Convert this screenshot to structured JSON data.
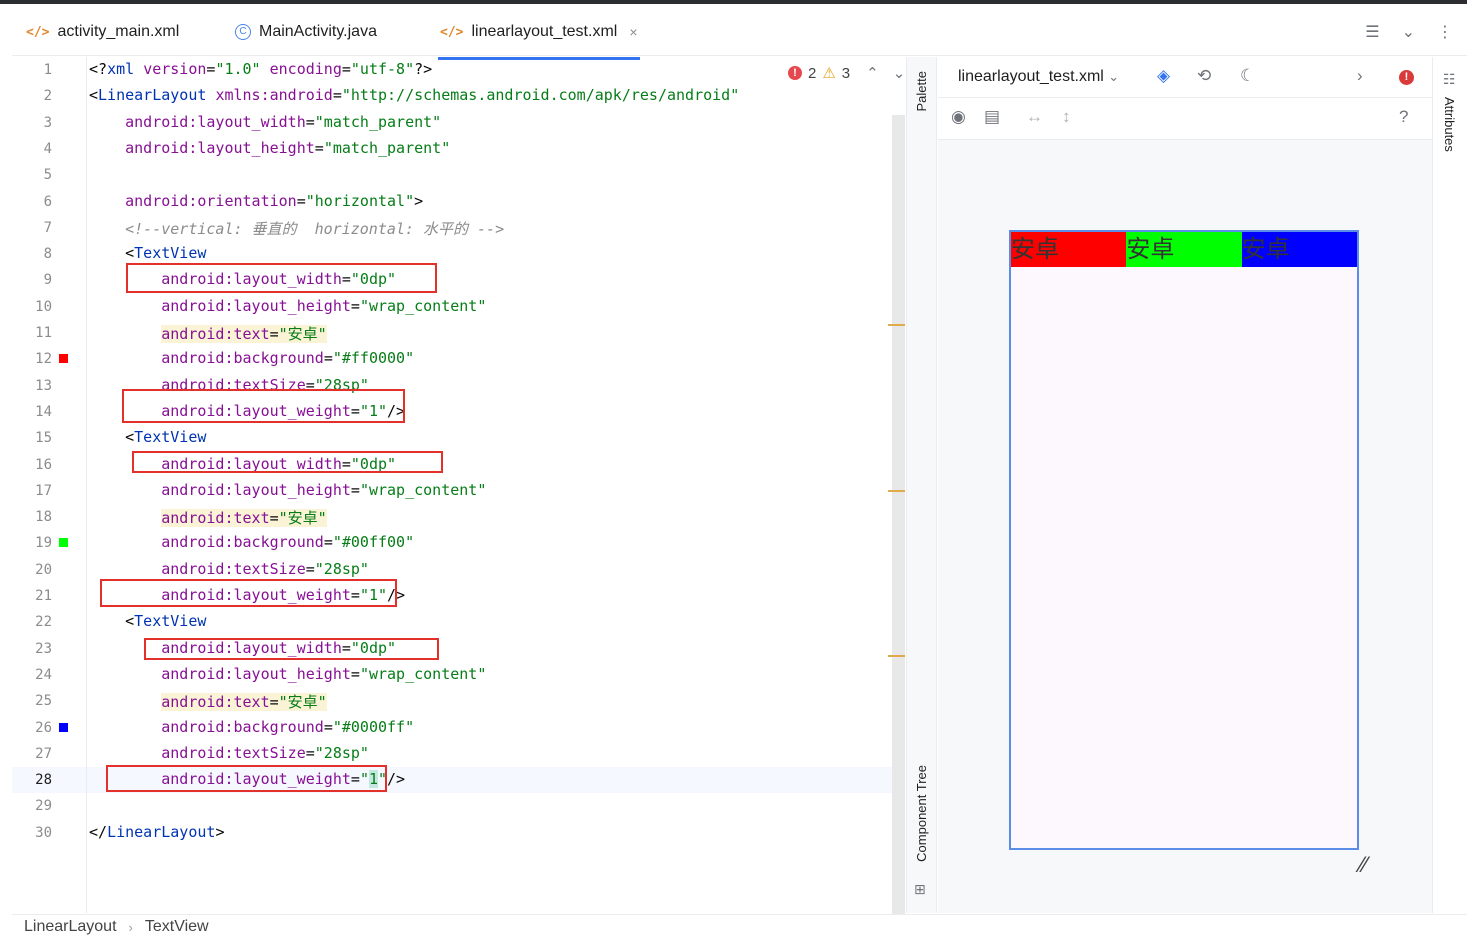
{
  "tabs": [
    {
      "label": "activity_main.xml",
      "icon": "xml-file-icon"
    },
    {
      "label": "MainActivity.java",
      "icon": "java-class-icon"
    },
    {
      "label": "linearlayout_test.xml",
      "icon": "xml-file-icon",
      "active": true
    }
  ],
  "tab_close": "×",
  "editor": {
    "status": {
      "errors": "2",
      "warnings": "3"
    },
    "lines": [
      {
        "n": "1",
        "tokens": [
          [
            "t",
            "<?"
          ],
          [
            "tag",
            "xml "
          ],
          [
            "attr",
            "version"
          ],
          [
            "t",
            "="
          ],
          [
            "str",
            "\"1.0\""
          ],
          [
            "t",
            " "
          ],
          [
            "attr",
            "encoding"
          ],
          [
            "t",
            "="
          ],
          [
            "str",
            "\"utf-8\""
          ],
          [
            "t",
            "?>"
          ]
        ]
      },
      {
        "n": "2",
        "tokens": [
          [
            "t",
            "<"
          ],
          [
            "tag",
            "LinearLayout "
          ],
          [
            "attr",
            "xmlns:android"
          ],
          [
            "t",
            "="
          ],
          [
            "str",
            "\"http://schemas.android.com/apk/res/android\""
          ]
        ]
      },
      {
        "n": "3",
        "tokens": [
          [
            "t",
            "    "
          ],
          [
            "attr",
            "android:layout_width"
          ],
          [
            "t",
            "="
          ],
          [
            "str",
            "\"match_parent\""
          ]
        ]
      },
      {
        "n": "4",
        "tokens": [
          [
            "t",
            "    "
          ],
          [
            "attr",
            "android:layout_height"
          ],
          [
            "t",
            "="
          ],
          [
            "str",
            "\"match_parent\""
          ]
        ]
      },
      {
        "n": "5",
        "tokens": []
      },
      {
        "n": "6",
        "tokens": [
          [
            "t",
            "    "
          ],
          [
            "attr",
            "android:orientation"
          ],
          [
            "t",
            "="
          ],
          [
            "str",
            "\"horizontal\""
          ],
          [
            "t",
            ">"
          ]
        ]
      },
      {
        "n": "7",
        "tokens": [
          [
            "t",
            "    "
          ],
          [
            "cmt",
            "<!--vertical: 垂直的  horizontal: 水平的 -->"
          ]
        ]
      },
      {
        "n": "8",
        "tokens": [
          [
            "t",
            "    <"
          ],
          [
            "tag",
            "TextView"
          ]
        ]
      },
      {
        "n": "9",
        "tokens": [
          [
            "t",
            "        "
          ],
          [
            "attr",
            "android:layout_width"
          ],
          [
            "t",
            "="
          ],
          [
            "str",
            "\"0dp\""
          ]
        ]
      },
      {
        "n": "10",
        "tokens": [
          [
            "t",
            "        "
          ],
          [
            "attr",
            "android:layout_height"
          ],
          [
            "t",
            "="
          ],
          [
            "str",
            "\"wrap_content\""
          ]
        ]
      },
      {
        "n": "11",
        "tokens": [
          [
            "t",
            "        "
          ],
          [
            "hlattr",
            "android:text"
          ],
          [
            "hlt",
            "="
          ],
          [
            "hlstr",
            "\"安卓\""
          ]
        ]
      },
      {
        "n": "12",
        "swatch": "#ff0000",
        "tokens": [
          [
            "t",
            "        "
          ],
          [
            "attr",
            "android:background"
          ],
          [
            "t",
            "="
          ],
          [
            "str",
            "\"#ff0000\""
          ]
        ]
      },
      {
        "n": "13",
        "tokens": [
          [
            "t",
            "        "
          ],
          [
            "attr",
            "android:textSize"
          ],
          [
            "t",
            "="
          ],
          [
            "str",
            "\"28sp\""
          ]
        ]
      },
      {
        "n": "14",
        "tokens": [
          [
            "t",
            "        "
          ],
          [
            "attr",
            "android:layout_weight"
          ],
          [
            "t",
            "="
          ],
          [
            "str",
            "\"1\""
          ],
          [
            "t",
            "/>"
          ]
        ]
      },
      {
        "n": "15",
        "tokens": [
          [
            "t",
            "    <"
          ],
          [
            "tag",
            "TextView"
          ]
        ]
      },
      {
        "n": "16",
        "tokens": [
          [
            "t",
            "        "
          ],
          [
            "attr",
            "android:layout_width"
          ],
          [
            "t",
            "="
          ],
          [
            "str",
            "\"0dp\""
          ]
        ]
      },
      {
        "n": "17",
        "tokens": [
          [
            "t",
            "        "
          ],
          [
            "attr",
            "android:layout_height"
          ],
          [
            "t",
            "="
          ],
          [
            "str",
            "\"wrap_content\""
          ]
        ]
      },
      {
        "n": "18",
        "tokens": [
          [
            "t",
            "        "
          ],
          [
            "hlattr",
            "android:text"
          ],
          [
            "hlt",
            "="
          ],
          [
            "hlstr",
            "\"安卓\""
          ]
        ]
      },
      {
        "n": "19",
        "swatch": "#00ff00",
        "tokens": [
          [
            "t",
            "        "
          ],
          [
            "attr",
            "android:background"
          ],
          [
            "t",
            "="
          ],
          [
            "str",
            "\"#00ff00\""
          ]
        ]
      },
      {
        "n": "20",
        "tokens": [
          [
            "t",
            "        "
          ],
          [
            "attr",
            "android:textSize"
          ],
          [
            "t",
            "="
          ],
          [
            "str",
            "\"28sp\""
          ]
        ]
      },
      {
        "n": "21",
        "tokens": [
          [
            "t",
            "        "
          ],
          [
            "attr",
            "android:layout_weight"
          ],
          [
            "t",
            "="
          ],
          [
            "str",
            "\"1\""
          ],
          [
            "t",
            "/>"
          ]
        ]
      },
      {
        "n": "22",
        "tokens": [
          [
            "t",
            "    <"
          ],
          [
            "tag",
            "TextView"
          ]
        ]
      },
      {
        "n": "23",
        "tokens": [
          [
            "t",
            "        "
          ],
          [
            "attr",
            "android:layout_width"
          ],
          [
            "t",
            "="
          ],
          [
            "str",
            "\"0dp\""
          ]
        ]
      },
      {
        "n": "24",
        "tokens": [
          [
            "t",
            "        "
          ],
          [
            "attr",
            "android:layout_height"
          ],
          [
            "t",
            "="
          ],
          [
            "str",
            "\"wrap_content\""
          ]
        ]
      },
      {
        "n": "25",
        "tokens": [
          [
            "t",
            "        "
          ],
          [
            "hlattr",
            "android:text"
          ],
          [
            "hlt",
            "="
          ],
          [
            "hlstr",
            "\"安卓\""
          ]
        ]
      },
      {
        "n": "26",
        "swatch": "#0000ff",
        "tokens": [
          [
            "t",
            "        "
          ],
          [
            "attr",
            "android:background"
          ],
          [
            "t",
            "="
          ],
          [
            "str",
            "\"#0000ff\""
          ]
        ]
      },
      {
        "n": "27",
        "tokens": [
          [
            "t",
            "        "
          ],
          [
            "attr",
            "android:textSize"
          ],
          [
            "t",
            "="
          ],
          [
            "str",
            "\"28sp\""
          ]
        ]
      },
      {
        "n": "28",
        "current": true,
        "tokens": [
          [
            "t",
            "        "
          ],
          [
            "attr",
            "android:layout_weight"
          ],
          [
            "t",
            "="
          ],
          [
            "str",
            "\""
          ],
          [
            "caret",
            "1"
          ],
          [
            "str",
            "\""
          ],
          [
            "t",
            "/>"
          ]
        ]
      },
      {
        "n": "29",
        "tokens": []
      },
      {
        "n": "30",
        "tokens": [
          [
            "t",
            "</"
          ],
          [
            "tag",
            "LinearLayout"
          ],
          [
            "t",
            ">"
          ]
        ]
      }
    ]
  },
  "sidebar": {
    "palette": "Palette",
    "component_tree": "Component Tree",
    "attributes": "Attributes"
  },
  "preview": {
    "file": "linearlayout_test.xml",
    "help": "?",
    "cells": [
      {
        "text": "安卓",
        "bg": "#ff0000"
      },
      {
        "text": "安卓",
        "bg": "#00ff00"
      },
      {
        "text": "安卓",
        "bg": "#0000ff"
      }
    ]
  },
  "breadcrumb": [
    "LinearLayout",
    "TextView"
  ]
}
